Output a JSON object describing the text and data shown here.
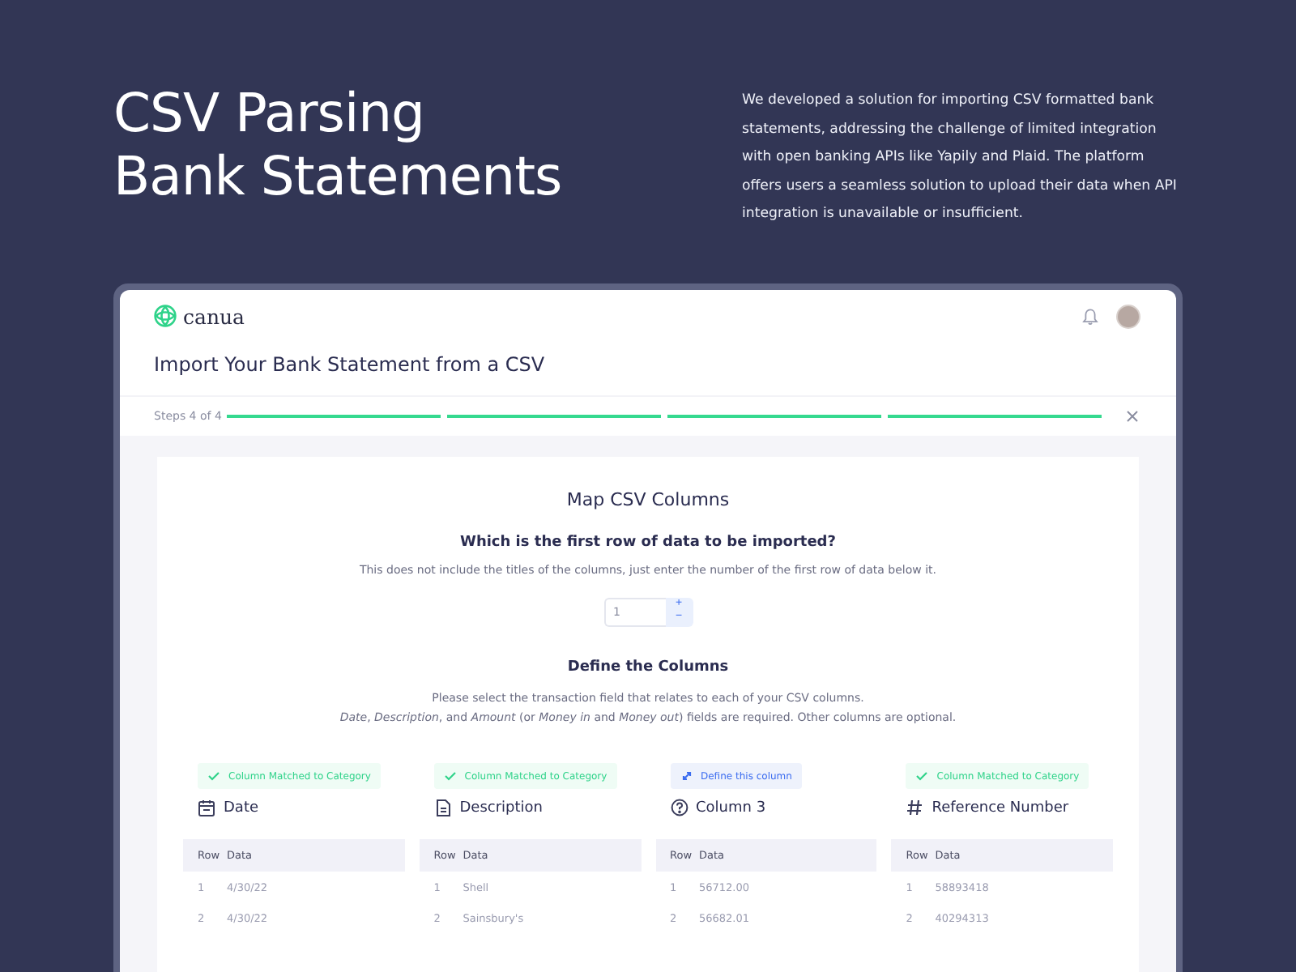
{
  "hero": {
    "title": "CSV Parsing\nBank Statements",
    "description": "We developed a solution for importing CSV formatted bank statements, addressing the challenge of limited integration with open banking APIs like Yapily and Plaid.  The platform offers users a seamless solution to upload their data when API integration is unavailable or insufficient."
  },
  "app": {
    "logo": "canua",
    "page_title": "Import Your Bank Statement from a CSV",
    "progress": {
      "label": "Steps 4 of 4",
      "steps": [
        {
          "complete": true
        },
        {
          "complete": true
        },
        {
          "complete": true
        },
        {
          "complete": true
        }
      ]
    },
    "panel": {
      "title": "Map CSV Columns",
      "question": "Which is the first row of data to be imported?",
      "hint": "This does not include the titles of the columns, just enter the number of the first row of data below it.",
      "first_row": {
        "value": "1",
        "increment": "+",
        "decrement": "−"
      },
      "define_title": "Define the Columns",
      "define_text": [
        "Please select the transaction field that relates to each of your CSV columns.",
        "*Date*, *Description*, and *Amount* (or *Money in* and *Money out*) fields are required. Other columns are optional."
      ],
      "columns": [
        {
          "matched": true,
          "status_label": "Column Matched to Category",
          "title": "Date",
          "headers": [
            "Row",
            "Data"
          ],
          "rows": [
            [
              "1",
              "4/30/22"
            ],
            [
              "2",
              "4/30/22"
            ]
          ]
        },
        {
          "matched": true,
          "status_label": "Column Matched to Category",
          "title": "Description",
          "headers": [
            "Row",
            "Data"
          ],
          "rows": [
            [
              "1",
              "Shell"
            ],
            [
              "2",
              "Sainsbury's"
            ]
          ]
        },
        {
          "matched": false,
          "status_label": "Define this column",
          "title": "Column 3",
          "headers": [
            "Row",
            "Data"
          ],
          "rows": [
            [
              "1",
              "56712.00"
            ],
            [
              "2",
              "56682.01"
            ]
          ]
        },
        {
          "matched": true,
          "status_label": "Column Matched to Category",
          "title": "Reference Number",
          "headers": [
            "Row",
            "Data"
          ],
          "rows": [
            [
              "1",
              "58893418"
            ],
            [
              "2",
              "40294313"
            ]
          ]
        }
      ]
    }
  }
}
